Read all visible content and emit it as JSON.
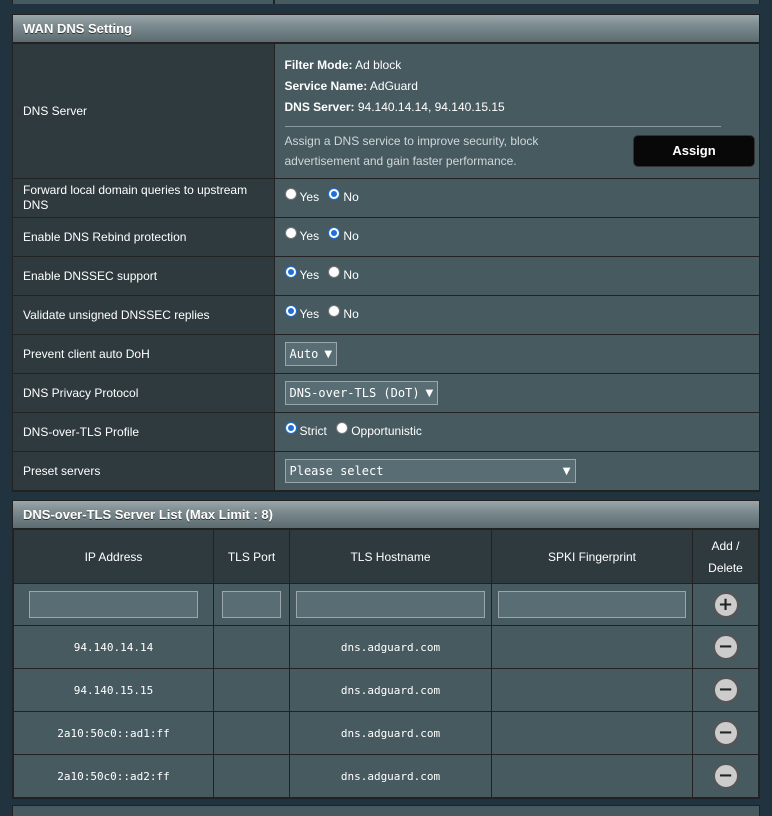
{
  "wan_dns": {
    "title": "WAN DNS Setting",
    "dns_server": {
      "label": "DNS Server",
      "filter_mode_label": "Filter Mode:",
      "filter_mode_value": "Ad block",
      "service_name_label": "Service Name:",
      "service_name_value": "AdGuard",
      "dns_server_label": "DNS Server:",
      "dns_server_value": "94.140.14.14, 94.140.15.15",
      "assign_desc": "Assign a DNS service to improve security, block advertisement and gain faster performance.",
      "assign_button": "Assign"
    },
    "rows": [
      {
        "label": "Forward local domain queries to upstream DNS",
        "options": [
          "Yes",
          "No"
        ],
        "selected": "No"
      },
      {
        "label": "Enable DNS Rebind protection",
        "options": [
          "Yes",
          "No"
        ],
        "selected": "No"
      },
      {
        "label": "Enable DNSSEC support",
        "options": [
          "Yes",
          "No"
        ],
        "selected": "Yes"
      },
      {
        "label": "Validate unsigned DNSSEC replies",
        "options": [
          "Yes",
          "No"
        ],
        "selected": "Yes"
      }
    ],
    "prevent_doh": {
      "label": "Prevent client auto DoH",
      "value": "Auto"
    },
    "privacy_protocol": {
      "label": "DNS Privacy Protocol",
      "value": "DNS-over-TLS (DoT)"
    },
    "dot_profile": {
      "label": "DNS-over-TLS Profile",
      "options": [
        "Strict",
        "Opportunistic"
      ],
      "selected": "Strict"
    },
    "preset": {
      "label": "Preset servers",
      "value": "Please select"
    }
  },
  "dot_list": {
    "title": "DNS-over-TLS Server List (Max Limit : 8)",
    "headers": {
      "ip": "IP Address",
      "port": "TLS Port",
      "host": "TLS Hostname",
      "spki": "SPKI Fingerprint",
      "add_delete_1": "Add /",
      "add_delete_2": "Delete"
    },
    "add_icon": "+",
    "delete_icon": "−",
    "entries": [
      {
        "ip": "94.140.14.14",
        "port": "",
        "host": "dns.adguard.com",
        "spki": ""
      },
      {
        "ip": "94.140.15.15",
        "port": "",
        "host": "dns.adguard.com",
        "spki": ""
      },
      {
        "ip": "2a10:50c0::ad1:ff",
        "port": "",
        "host": "dns.adguard.com",
        "spki": ""
      },
      {
        "ip": "2a10:50c0::ad2:ff",
        "port": "",
        "host": "dns.adguard.com",
        "spki": ""
      }
    ]
  }
}
